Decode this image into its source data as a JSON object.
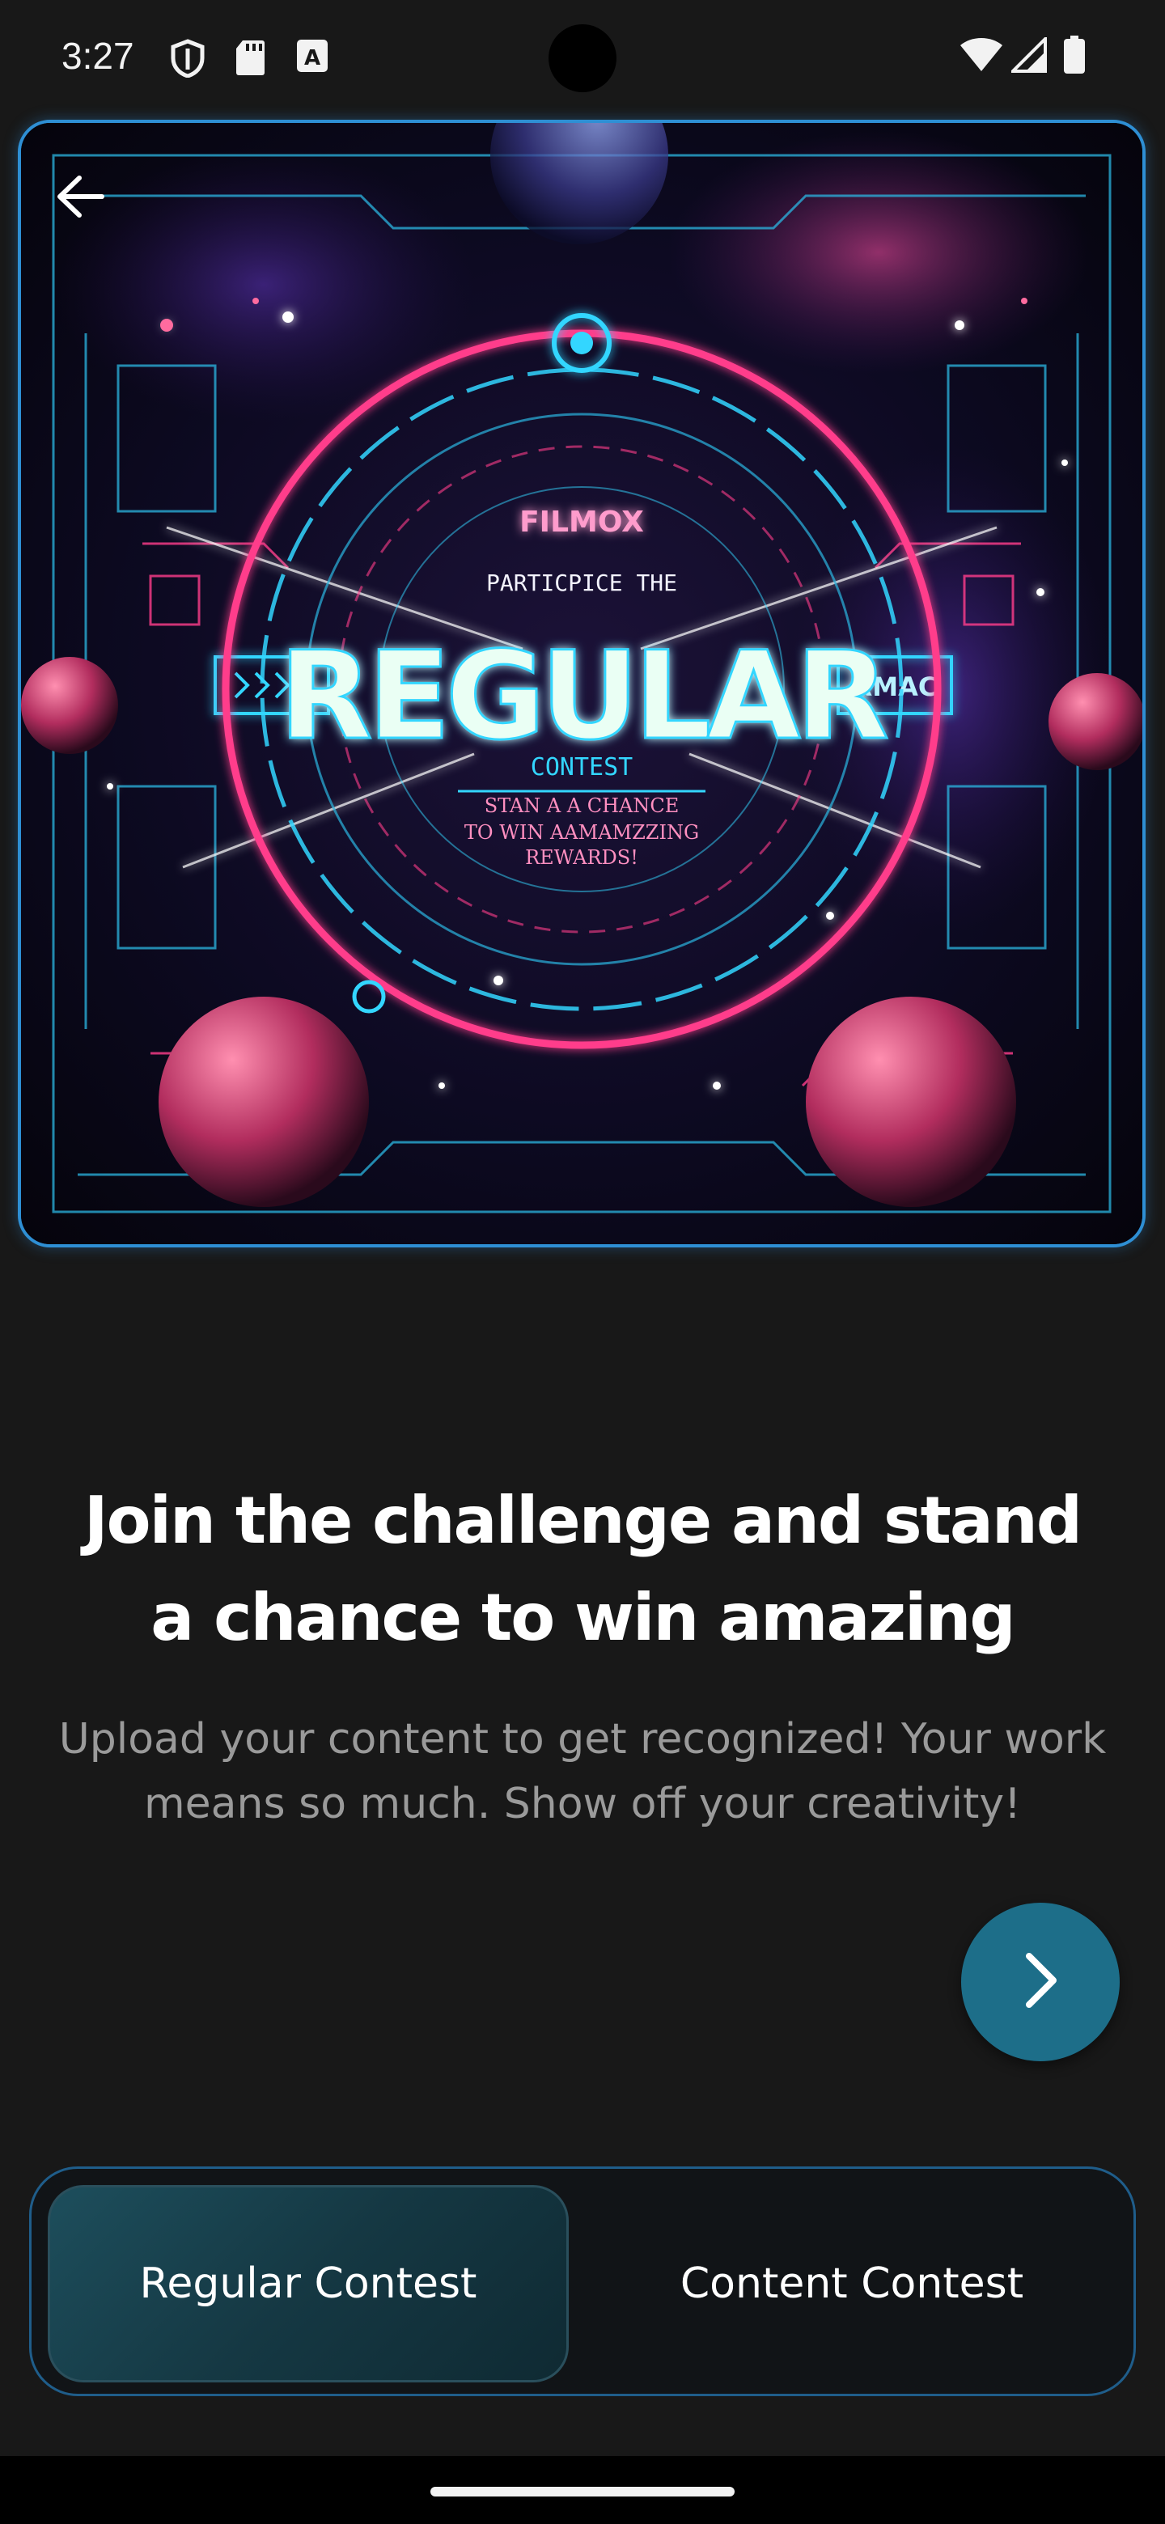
{
  "status_bar": {
    "time": "3:27",
    "left_icons": [
      "shield-icon",
      "sd-card-icon",
      "font-a-icon"
    ],
    "right_icons": [
      "wifi-icon",
      "signal-icon",
      "battery-icon"
    ]
  },
  "hero": {
    "brand": "FILMOX",
    "line1": "PARTICPICE THE",
    "title": "REGULAR",
    "side_label": "RMAC",
    "contest": "CONTEST",
    "line2": "STAN A A CHANCE",
    "line3": "TO WIN AAMAMZZING",
    "line4": "REWARDS!",
    "colors": {
      "pink": "#ff3d8b",
      "cyan": "#33d6ff",
      "title": "#eafff4",
      "border": "#2e8fd4"
    }
  },
  "headline": {
    "line1": "Join the challenge and stand",
    "line2": "a chance to win amazing"
  },
  "subtitle": "Upload your content to get recognized! Your work means so much. Show off your creativity!",
  "next_button": {
    "icon": "chevron-right-icon",
    "color": "#1d6e89"
  },
  "segmented_control": {
    "options": [
      "Regular Contest",
      "Content Contest"
    ],
    "selected": "Regular Contest"
  }
}
